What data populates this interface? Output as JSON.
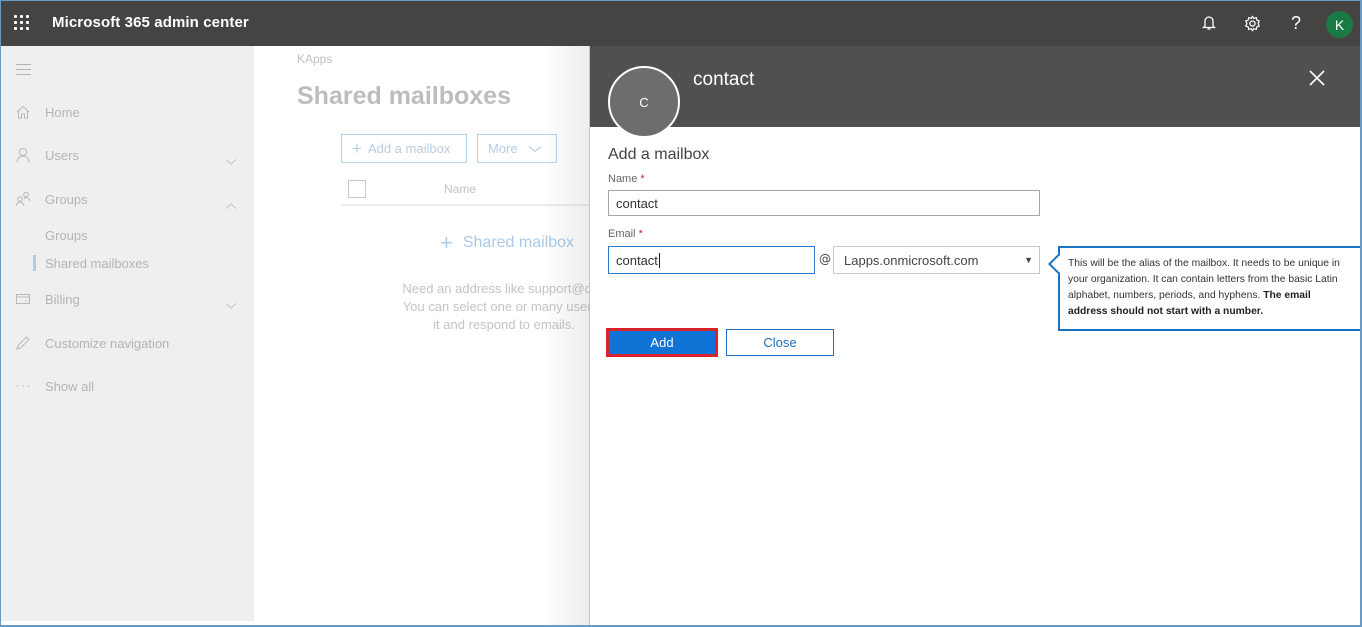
{
  "topbar": {
    "app_title": "Microsoft 365 admin center",
    "icons": [
      "app-launcher-icon",
      "bell-icon",
      "gear-icon",
      "help-icon"
    ],
    "user_initial": "K",
    "user_avatar_color": "#1a7a46"
  },
  "leftnav": {
    "items": [
      {
        "label": "Home",
        "icon": "home-icon"
      },
      {
        "label": "Users",
        "icon": "user-icon",
        "expand": "chevron-down"
      },
      {
        "label": "Groups",
        "icon": "groups-icon",
        "expand": "chevron-up"
      },
      {
        "label": "Billing",
        "icon": "billing-icon",
        "expand": "chevron-down"
      },
      {
        "label": "Customize navigation",
        "icon": "pencil-icon"
      },
      {
        "label": "Show all",
        "icon": "more-icon"
      }
    ],
    "group_subitems": [
      {
        "label": "Groups",
        "active": false
      },
      {
        "label": "Shared mailboxes",
        "active": true
      }
    ]
  },
  "main": {
    "breadcrumb": "KApps",
    "page_title": "Shared mailboxes",
    "toolbar": {
      "add_label": "Add a mailbox",
      "more_label": "More"
    },
    "table": {
      "columns": [
        "Name"
      ]
    },
    "empty_state": {
      "add_label": "Shared mailbox",
      "description_lines": [
        "Need an address like support@con",
        "You can select one or many users t",
        "it and respond to emails."
      ]
    }
  },
  "panel": {
    "avatar_initial": "C",
    "title": "contact",
    "section_title": "Add a mailbox",
    "name_label": "Name",
    "name_value": "contact",
    "email_label": "Email",
    "email_value": "contact",
    "required_mark": "*",
    "at_sign": "@",
    "domain_selected": "Lapps.onmicrosoft.com",
    "tooltip": {
      "text": "This will be the alias of the mailbox. It needs to be unique in your organization. It can contain letters from the basic Latin alphabet, numbers, periods, and hyphens.",
      "bold_text": "The email address should not start with a number."
    },
    "add_button": "Add",
    "close_button": "Close",
    "colors": {
      "primary": "#0f74d6",
      "highlight_border": "#d8232a",
      "focus": "#2b7cd3"
    }
  }
}
